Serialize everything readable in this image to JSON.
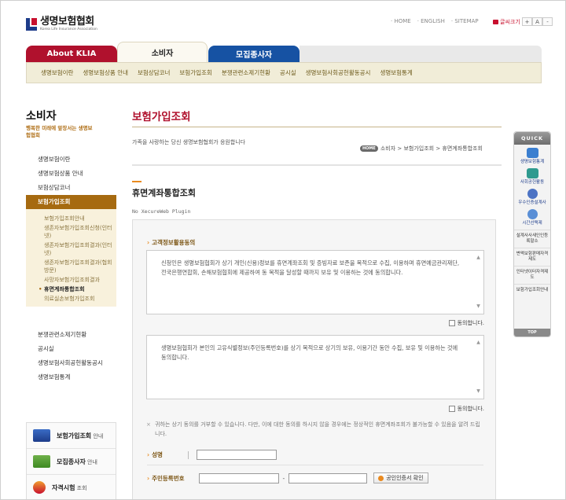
{
  "header": {
    "logo_title": "생명보험협회",
    "logo_sub": "Korea Life Insurance Association",
    "links": [
      "· HOME",
      "· ENGLISH",
      "· SITEMAP"
    ],
    "print_label": "글씨크기",
    "font_plus": "+",
    "font_a": "A",
    "font_minus": "-"
  },
  "tabs": {
    "about": "About KLIA",
    "consumer": "소비자",
    "agent": "모집종사자"
  },
  "subnav": [
    "생명보험이란",
    "생명보험상품 안내",
    "보험상담코너",
    "보험가입조회",
    "분쟁관련소제기현황",
    "공시실",
    "생명보험사회공헌활동공시",
    "생명보험통계"
  ],
  "sidebar": {
    "title": "소비자",
    "slogan": "행복한 미래에 앞장서는 생명보험협회",
    "items_top": [
      "생명보험이란",
      "생명보험상품 안내",
      "보험상담코너"
    ],
    "active": "보험가입조회",
    "sub_items": [
      "보험가입조회안내",
      "생존자보험가입조회신청(인터넷)",
      "생존자보험가입조회결과(인터넷)",
      "생존자보험가입조회결과(협회방문)",
      "사망자보험가입조회결과",
      "휴면계좌통합조회",
      "의료실손보험가입조회"
    ],
    "items_bottom": [
      "분쟁관련소제기현황",
      "공시실",
      "생명보험사회공헌활동공시",
      "생명보험통계"
    ],
    "banners": [
      {
        "title": "보험가입조회",
        "suffix": " 안내"
      },
      {
        "title": "모집종사자",
        "suffix": " 안내"
      },
      {
        "title": "자격시험",
        "suffix": " 조회"
      }
    ]
  },
  "content": {
    "page_title": "보험가입조회",
    "desc": "가족을 사랑하는 당신 생명보험협회가 응원합니다",
    "breadcrumb_home": "HOME",
    "breadcrumb": "소비자 > 보험가입조회 > 휴면계좌통합조회",
    "section_title": "휴면계좌통합조회",
    "plugin_note": "No XecureWeb Plugin",
    "consent_head": "고객정보활용동의",
    "consent1": "신청인은 생명보험협회가 상기 개인(신용)정보를 휴면계좌조회 및 증빙자료 보존을 목적으로 수집, 이용하며 휴면예금관리재단, 전국은행연합회, 손해보험협회에 제공하여 동 목적을 달성할 때까지 보유 및 이용하는 것에 동의합니다.",
    "consent2": "생명보험협회가 본인의 고유식별정보(주민등록번호)를 상기 목적으로 상기의 보유, 이용기간 동안 수집, 보유 및 이용하는 것에 동의합니다.",
    "agree_label": "동의합니다.",
    "notice": "귀하는 상기 동의를 거부할 수 있습니다. 다만, 이에 대한 동의를 하시지 않을 경우에는 정상적인 휴면계좌조회가 불가능할 수 있음을 알려 드립니다.",
    "name_label": "성명",
    "rrn_label": "주민등록번호",
    "cert_button": "공인인증서 확인"
  },
  "quick": {
    "head": "QUICK",
    "icons": [
      "생명보험통계",
      "사회공헌활동",
      "우수인증설계사",
      "시간선택제"
    ],
    "texts": [
      "설계사사새인인등록말소",
      "변액보험판매자격제도",
      "인터넷이터자격제도",
      "보험가입조회안내"
    ],
    "top": "TOP"
  }
}
